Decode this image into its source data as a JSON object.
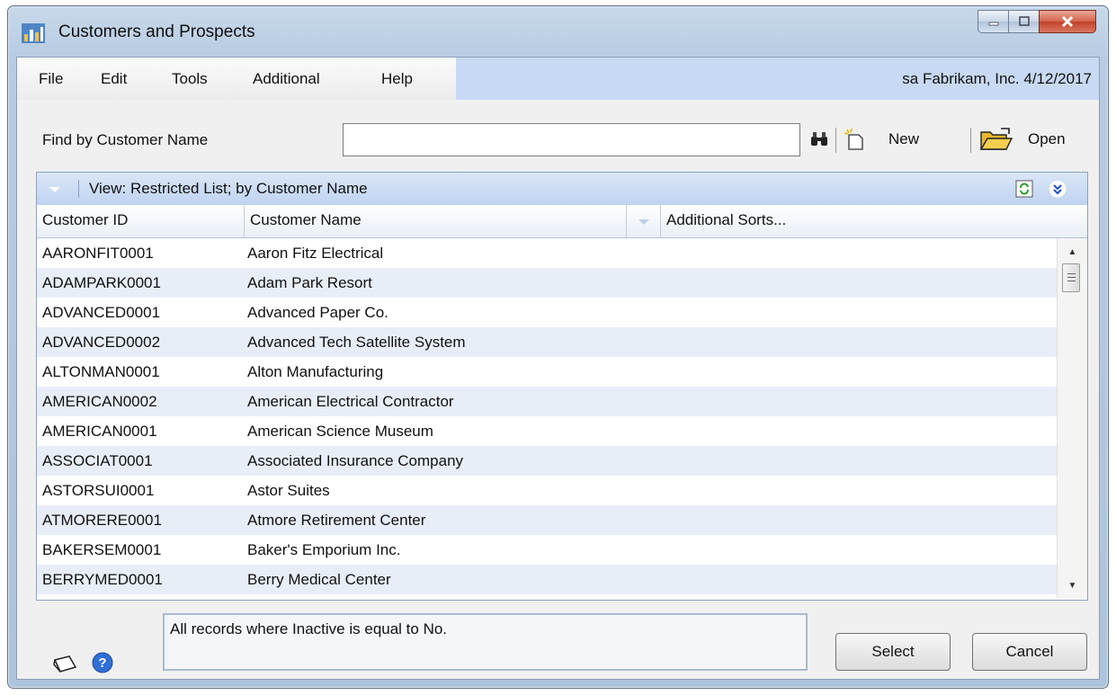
{
  "window": {
    "title": "Customers and Prospects",
    "controls": {
      "minimize": "minimize",
      "maximize": "maximize",
      "close": "close"
    }
  },
  "menubar": {
    "items": [
      "File",
      "Edit",
      "Tools",
      "Additional",
      "Help"
    ],
    "status": "sa  Fabrikam, Inc.  4/12/2017"
  },
  "find": {
    "label": "Find by Customer Name",
    "value": "",
    "placeholder": ""
  },
  "toolbar": {
    "find_icon": "binoculars-icon",
    "new_label": "New",
    "new_icon": "new-document-icon",
    "open_label": "Open",
    "open_icon": "folder-open-icon"
  },
  "view": {
    "label": "View: Restricted List; by Customer Name"
  },
  "table": {
    "columns": [
      "Customer ID",
      "Customer Name",
      "Additional Sorts..."
    ],
    "rows": [
      [
        "AARONFIT0001",
        "Aaron Fitz Electrical"
      ],
      [
        "ADAMPARK0001",
        "Adam Park Resort"
      ],
      [
        "ADVANCED0001",
        "Advanced Paper Co."
      ],
      [
        "ADVANCED0002",
        "Advanced Tech Satellite System"
      ],
      [
        "ALTONMAN0001",
        "Alton Manufacturing"
      ],
      [
        "AMERICAN0002",
        "American Electrical Contractor"
      ],
      [
        "AMERICAN0001",
        "American Science Museum"
      ],
      [
        "ASSOCIAT0001",
        "Associated Insurance Company"
      ],
      [
        "ASTORSUI0001",
        "Astor Suites"
      ],
      [
        "ATMORERE0001",
        "Atmore Retirement Center"
      ],
      [
        "BAKERSEM0001",
        "Baker's Emporium Inc."
      ],
      [
        "BERRYMED0001",
        "Berry Medical Center"
      ]
    ]
  },
  "restriction_note": "All records where Inactive is equal to No.",
  "buttons": {
    "select": "Select",
    "cancel": "Cancel"
  },
  "colors": {
    "accent": "#c7d9f3",
    "row_alt": "#e8eef8",
    "close": "#c2412a"
  }
}
